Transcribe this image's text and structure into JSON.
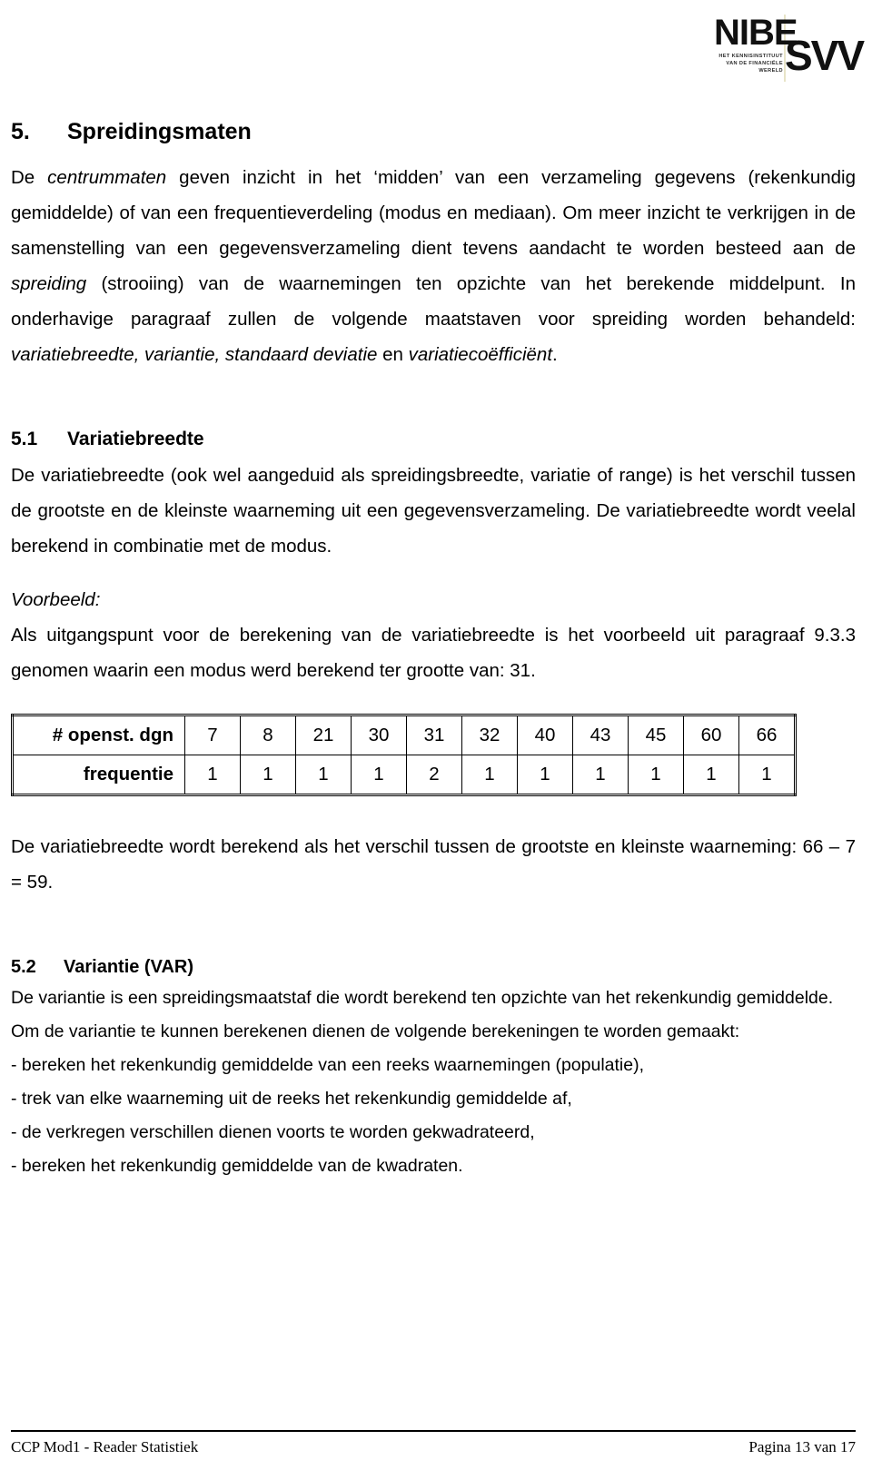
{
  "logo": {
    "brand_first": "NIBE",
    "brand_second": "SVV",
    "tagline": "Het kennisinstituut van de financiële wereld"
  },
  "document": {
    "section": {
      "number": "5.",
      "title": "Spreidingsmaten",
      "intro_part1": "De ",
      "intro_italic1": "centrummaten",
      "intro_part2": " geven inzicht in het ‘midden’ van een verzameling gegevens (rekenkundig gemiddelde) of van een frequentieverdeling (modus en mediaan). Om meer inzicht te verkrijgen in de samenstelling van een gegevensverzameling dient tevens aandacht te worden besteed aan de ",
      "intro_italic2": "spreiding",
      "intro_part3": " (strooiing) van de waarnemingen ten opzichte van het berekende middelpunt. In onderhavige paragraaf zullen de volgende maatstaven voor spreiding worden behandeld: ",
      "intro_italic3": "variatiebreedte, variantie, standaard deviatie",
      "intro_part4": " en ",
      "intro_italic4": "variatiecoëfficiënt",
      "intro_part5": "."
    },
    "subsection_51": {
      "number": "5.1",
      "title": "Variatiebreedte",
      "paragraph": "De variatiebreedte (ook wel aangeduid als spreidingsbreedte, variatie of range) is het verschil tussen de grootste en de kleinste waarneming uit een gegevensverzameling. De variatiebreedte wordt veelal berekend in combinatie met de modus.",
      "example_label": "Voorbeeld:",
      "example_paragraph": "Als uitgangspunt voor de berekening van de variatiebreedte is het voorbeeld uit paragraaf 9.3.3 genomen waarin een modus werd berekend ter grootte van: 31.",
      "conclusion": "De variatiebreedte wordt berekend als het verschil tussen de grootste en kleinste waarneming: 66 – 7 = 59."
    },
    "table": {
      "row_labels": [
        "# openst. dgn",
        "frequentie"
      ],
      "openstaande_dagen": [
        "7",
        "8",
        "21",
        "30",
        "31",
        "32",
        "40",
        "43",
        "45",
        "60",
        "66"
      ],
      "frequentie": [
        "1",
        "1",
        "1",
        "1",
        "2",
        "1",
        "1",
        "1",
        "1",
        "1",
        "1"
      ]
    },
    "subsection_52": {
      "number": "5.2",
      "title": "Variantie (VAR)",
      "paragraph": "De variantie is een spreidingsmaatstaf die wordt berekend ten opzichte van het rekenkundig gemiddelde. Om de variantie te kunnen berekenen dienen de volgende berekeningen te worden gemaakt:",
      "steps": [
        "- bereken het rekenkundig gemiddelde van een reeks waarnemingen (populatie),",
        "- trek van elke waarneming uit de reeks het rekenkundig gemiddelde af,",
        "- de verkregen verschillen dienen voorts te worden gekwadrateerd,",
        "- bereken het rekenkundig gemiddelde van de kwadraten."
      ]
    }
  },
  "footer": {
    "left": "CCP Mod1 - Reader Statistiek",
    "right": "Pagina 13 van 17"
  }
}
